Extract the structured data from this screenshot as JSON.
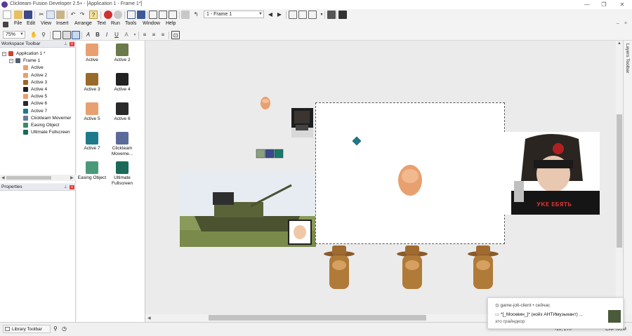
{
  "window": {
    "title": "Clickteam Fusion Developer 2.5+ - [Application 1 - Frame 1*]",
    "controls": [
      "—",
      "❐",
      "✕"
    ]
  },
  "toolbar": {
    "frame_selector": "1 - Frame 1"
  },
  "menu": [
    "File",
    "Edit",
    "View",
    "Insert",
    "Arrange",
    "Text",
    "Run",
    "Tools",
    "Window",
    "Help"
  ],
  "format_toolbar": {
    "zoom": "75%",
    "text_buttons": [
      "B",
      "I",
      "U"
    ]
  },
  "workspace": {
    "header": "Workspace Toolbar",
    "tree": [
      {
        "label": "Application 1 *",
        "level": 0,
        "icon_color": "#d04030"
      },
      {
        "label": "Frame 1",
        "level": 1,
        "icon_color": "#506070"
      },
      {
        "label": "Active",
        "level": 2,
        "icon_color": "#e8a070"
      },
      {
        "label": "Active 2",
        "level": 2,
        "icon_color": "#e8a070"
      },
      {
        "label": "Active 3",
        "level": 2,
        "icon_color": "#9a6a2a"
      },
      {
        "label": "Active 4",
        "level": 2,
        "icon_color": "#222222"
      },
      {
        "label": "Active 5",
        "level": 2,
        "icon_color": "#e8a070"
      },
      {
        "label": "Active 6",
        "level": 2,
        "icon_color": "#2a2a2a"
      },
      {
        "label": "Active 7",
        "level": 2,
        "icon_color": "#1e7a8a"
      },
      {
        "label": "Clickteam Movemer",
        "level": 2,
        "icon_color": "#6a7a9a"
      },
      {
        "label": "Easing Object",
        "level": 2,
        "icon_color": "#3a8a6a"
      },
      {
        "label": "Ultimate Fullscreen",
        "level": 2,
        "icon_color": "#1a6a5a"
      }
    ]
  },
  "properties": {
    "header": "Properties"
  },
  "object_library": [
    {
      "label": "Active",
      "color": "#e8a070"
    },
    {
      "label": "Active 2",
      "color": "#6a7a4a"
    },
    {
      "label": "Active 3",
      "color": "#9a6a2a"
    },
    {
      "label": "Active 4",
      "color": "#222222"
    },
    {
      "label": "Active 5",
      "color": "#e8a070"
    },
    {
      "label": "Active 6",
      "color": "#2a2a2a"
    },
    {
      "label": "Active 7",
      "color": "#1e7a8a"
    },
    {
      "label": "Clickteam Moveme...",
      "color": "#5a6a9a"
    },
    {
      "label": "Easing Object",
      "color": "#4a9a7a"
    },
    {
      "label": "Ultimate Fullscreen",
      "color": "#1a6a5a"
    }
  ],
  "layers_toolbar": "Layers Toolbar",
  "statusbar": {
    "library": "Library Toolbar",
    "coords": "-10, 270",
    "caps": "CAP NUM"
  },
  "notification": {
    "source": "game-jolt-client",
    "time": "сейчас",
    "message": "*[_Москвин_]* (нойз АНТИмузыкант) ...",
    "sub": "это грайндкор"
  },
  "colors": {
    "canvas_bg": "#ebebeb",
    "frame_bg": "#ffffff",
    "accent_red": "#d03030"
  }
}
